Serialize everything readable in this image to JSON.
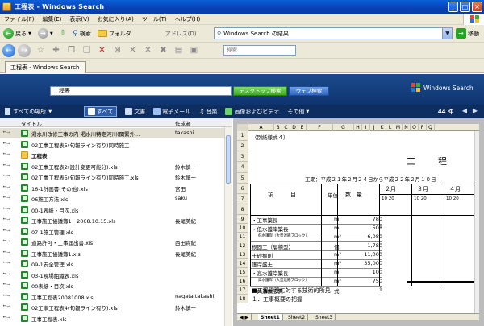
{
  "window": {
    "title": "工程表 - Windows Search"
  },
  "menu": [
    "ファイル(F)",
    "編集(E)",
    "表示(V)",
    "お気に入り(A)",
    "ツール(T)",
    "ヘルプ(H)"
  ],
  "toolbar": {
    "back": "戻る",
    "search": "検索",
    "folder": "フォルダ",
    "address_label": "アドレス(D)",
    "address_value": "Windows Search の結果",
    "go": "移動",
    "search_placeholder": "検索"
  },
  "tab": {
    "label": "工程表 - Windows Search"
  },
  "search": {
    "query": "工程表",
    "desktop_button": "デスクトップ検索",
    "web_button": "ウェブ検索",
    "brand": "Windows Search"
  },
  "filters": {
    "location": "すべての場所",
    "items": [
      {
        "label": "すべて",
        "color": "#ffffff"
      },
      {
        "label": "文書",
        "color": "#cfe0ff"
      },
      {
        "label": "電子メール",
        "color": "#9ec0f0"
      },
      {
        "label": "音楽",
        "color": "#d8e8ff"
      },
      {
        "label": "画像およびビデオ",
        "color": "#6fd06f"
      },
      {
        "label": "その他",
        "color": "#cfe0ff"
      }
    ],
    "count": "44 件"
  },
  "results": {
    "columns": {
      "title": "タイトル",
      "author": "作成者"
    },
    "rows": [
      {
        "name": "渇水川改修工事の内 渇水川特定河川(関緊外...",
        "author": "takashi",
        "type": "xls"
      },
      {
        "name": "02工事工程表5(旬報ライン有り)同時施工",
        "author": "",
        "type": "xls"
      },
      {
        "name": "工程表",
        "author": "",
        "type": "folder",
        "bold": true
      },
      {
        "name": "02工事工程表2(設計変更可能分).xls",
        "author": "鈴木慎一",
        "type": "xls"
      },
      {
        "name": "02工事工程表5(旬報ライン有り)同時施工.xls",
        "author": "鈴木慎一",
        "type": "xls"
      },
      {
        "name": "16-1計画書(その他).xls",
        "author": "宮田",
        "type": "xls"
      },
      {
        "name": "06施工方法.xls",
        "author": "saku",
        "type": "xls"
      },
      {
        "name": "00-1表紙・目次.xls",
        "author": "",
        "type": "xls"
      },
      {
        "name": "工事施工協議簿1　2008.10.15.xls",
        "author": "長尾美紀",
        "type": "xls"
      },
      {
        "name": "07-1施工管理.xls",
        "author": "",
        "type": "xls"
      },
      {
        "name": "道路許可・工事届出書.xls",
        "author": "西田貴紀",
        "type": "xls"
      },
      {
        "name": "工事施工協議簿1.xls",
        "author": "長尾美紀",
        "type": "xls"
      },
      {
        "name": "09-1安全管理.xls",
        "author": "",
        "type": "xls"
      },
      {
        "name": "03-1現場組織表.xls",
        "author": "",
        "type": "xls"
      },
      {
        "name": "00表紙・目次.xls",
        "author": "",
        "type": "xls"
      },
      {
        "name": "工事工程表20081008.xls",
        "author": "nagata takashi",
        "type": "xls"
      },
      {
        "name": "02工事工程表4(旬報ライン有り).xls",
        "author": "鈴木慎一",
        "type": "xls"
      },
      {
        "name": "工事工程表.xls",
        "author": "",
        "type": "xls"
      }
    ]
  },
  "preview": {
    "columns": [
      "A",
      "B",
      "C",
      "D",
      "E",
      "F",
      "G",
      "H",
      "I",
      "J",
      "K",
      "L",
      "M",
      "N",
      "O",
      "P",
      "Q"
    ],
    "row_numbers": [
      "1",
      "2",
      "3",
      "4",
      "5",
      "6",
      "7",
      "8",
      "9",
      "10",
      "11",
      "12",
      "13",
      "14",
      "15",
      "16",
      "17",
      "18"
    ],
    "form_no": "（別紙様式４）",
    "title": "工　　程",
    "period": "工期：平成２１年２月２４日から平成２２年２月１０日",
    "header_item": "項　　　目",
    "header_unit": "単位",
    "header_qty": "数　量",
    "months": [
      "２月",
      "３月",
      "４月"
    ],
    "decades": [
      "10 20",
      "10 20",
      "10 20"
    ],
    "items": [
      {
        "name": "・工事築長",
        "unit": "m",
        "qty": "780"
      },
      {
        "name": "・低水護岸築長",
        "unit": "m",
        "qty": "508"
      },
      {
        "name": "低水護岸（大型連節ブロック）",
        "unit": "m²",
        "qty": "6,080"
      },
      {
        "name": "根固工（層積型）",
        "unit": "個",
        "qty": "1,780"
      },
      {
        "name": "土砂掘削",
        "unit": "m³",
        "qty": "11,000"
      },
      {
        "name": "護岸盛土",
        "unit": "m³",
        "qty": "35,000"
      },
      {
        "name": "・高水護岸築長",
        "unit": "m",
        "qty": "100"
      },
      {
        "name": "高水護岸（大型連節ブロック）",
        "unit": "m²",
        "qty": "750"
      },
      {
        "name": "・共通仮設費",
        "unit": "式",
        "qty": "1"
      }
    ],
    "note_heading": "■工程管理に対する技術的所見",
    "note_1": "１．工事概要の把握",
    "sheet_tabs": [
      "Sheet1",
      "Sheet2",
      "Sheet3"
    ]
  }
}
